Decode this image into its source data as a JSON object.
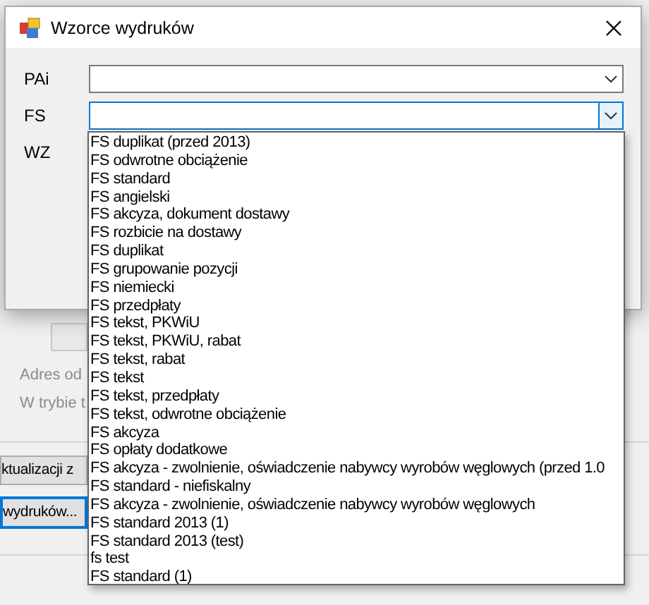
{
  "background_window": {
    "address_label": "Adres od",
    "mode_label": "W trybie t",
    "buttons": [
      {
        "label": "ktualizacji z",
        "default": false
      },
      {
        "label": "wydruków...",
        "default": true
      }
    ]
  },
  "dialog": {
    "title": "Wzorce wydruków",
    "combos": [
      {
        "label": "PAi",
        "focused": false
      },
      {
        "label": "FS",
        "focused": true
      }
    ],
    "hidden_combo_label": "WZ"
  },
  "dropdown": {
    "items": [
      "FS duplikat (przed 2013)",
      "FS odwrotne obciążenie",
      "FS standard",
      "FS angielski",
      "FS akcyza, dokument dostawy",
      "FS rozbicie na dostawy",
      "FS duplikat",
      "FS grupowanie pozycji",
      "FS niemiecki",
      "FS przedpłaty",
      "FS tekst, PKWiU",
      "FS tekst, PKWiU, rabat",
      "FS tekst, rabat",
      "FS tekst",
      "FS tekst, przedpłaty",
      "FS tekst, odwrotne obciążenie",
      "FS akcyza",
      "FS opłaty dodatkowe",
      "FS akcyza - zwolnienie, oświadczenie nabywcy wyrobów węglowych (przed 1.0",
      "FS standard - niefiskalny",
      "FS akcyza - zwolnienie, oświadczenie nabywcy wyrobów węglowych",
      "FS standard 2013 (1)",
      "FS standard 2013 (test)",
      "fs test",
      "FS standard (1)"
    ]
  }
}
